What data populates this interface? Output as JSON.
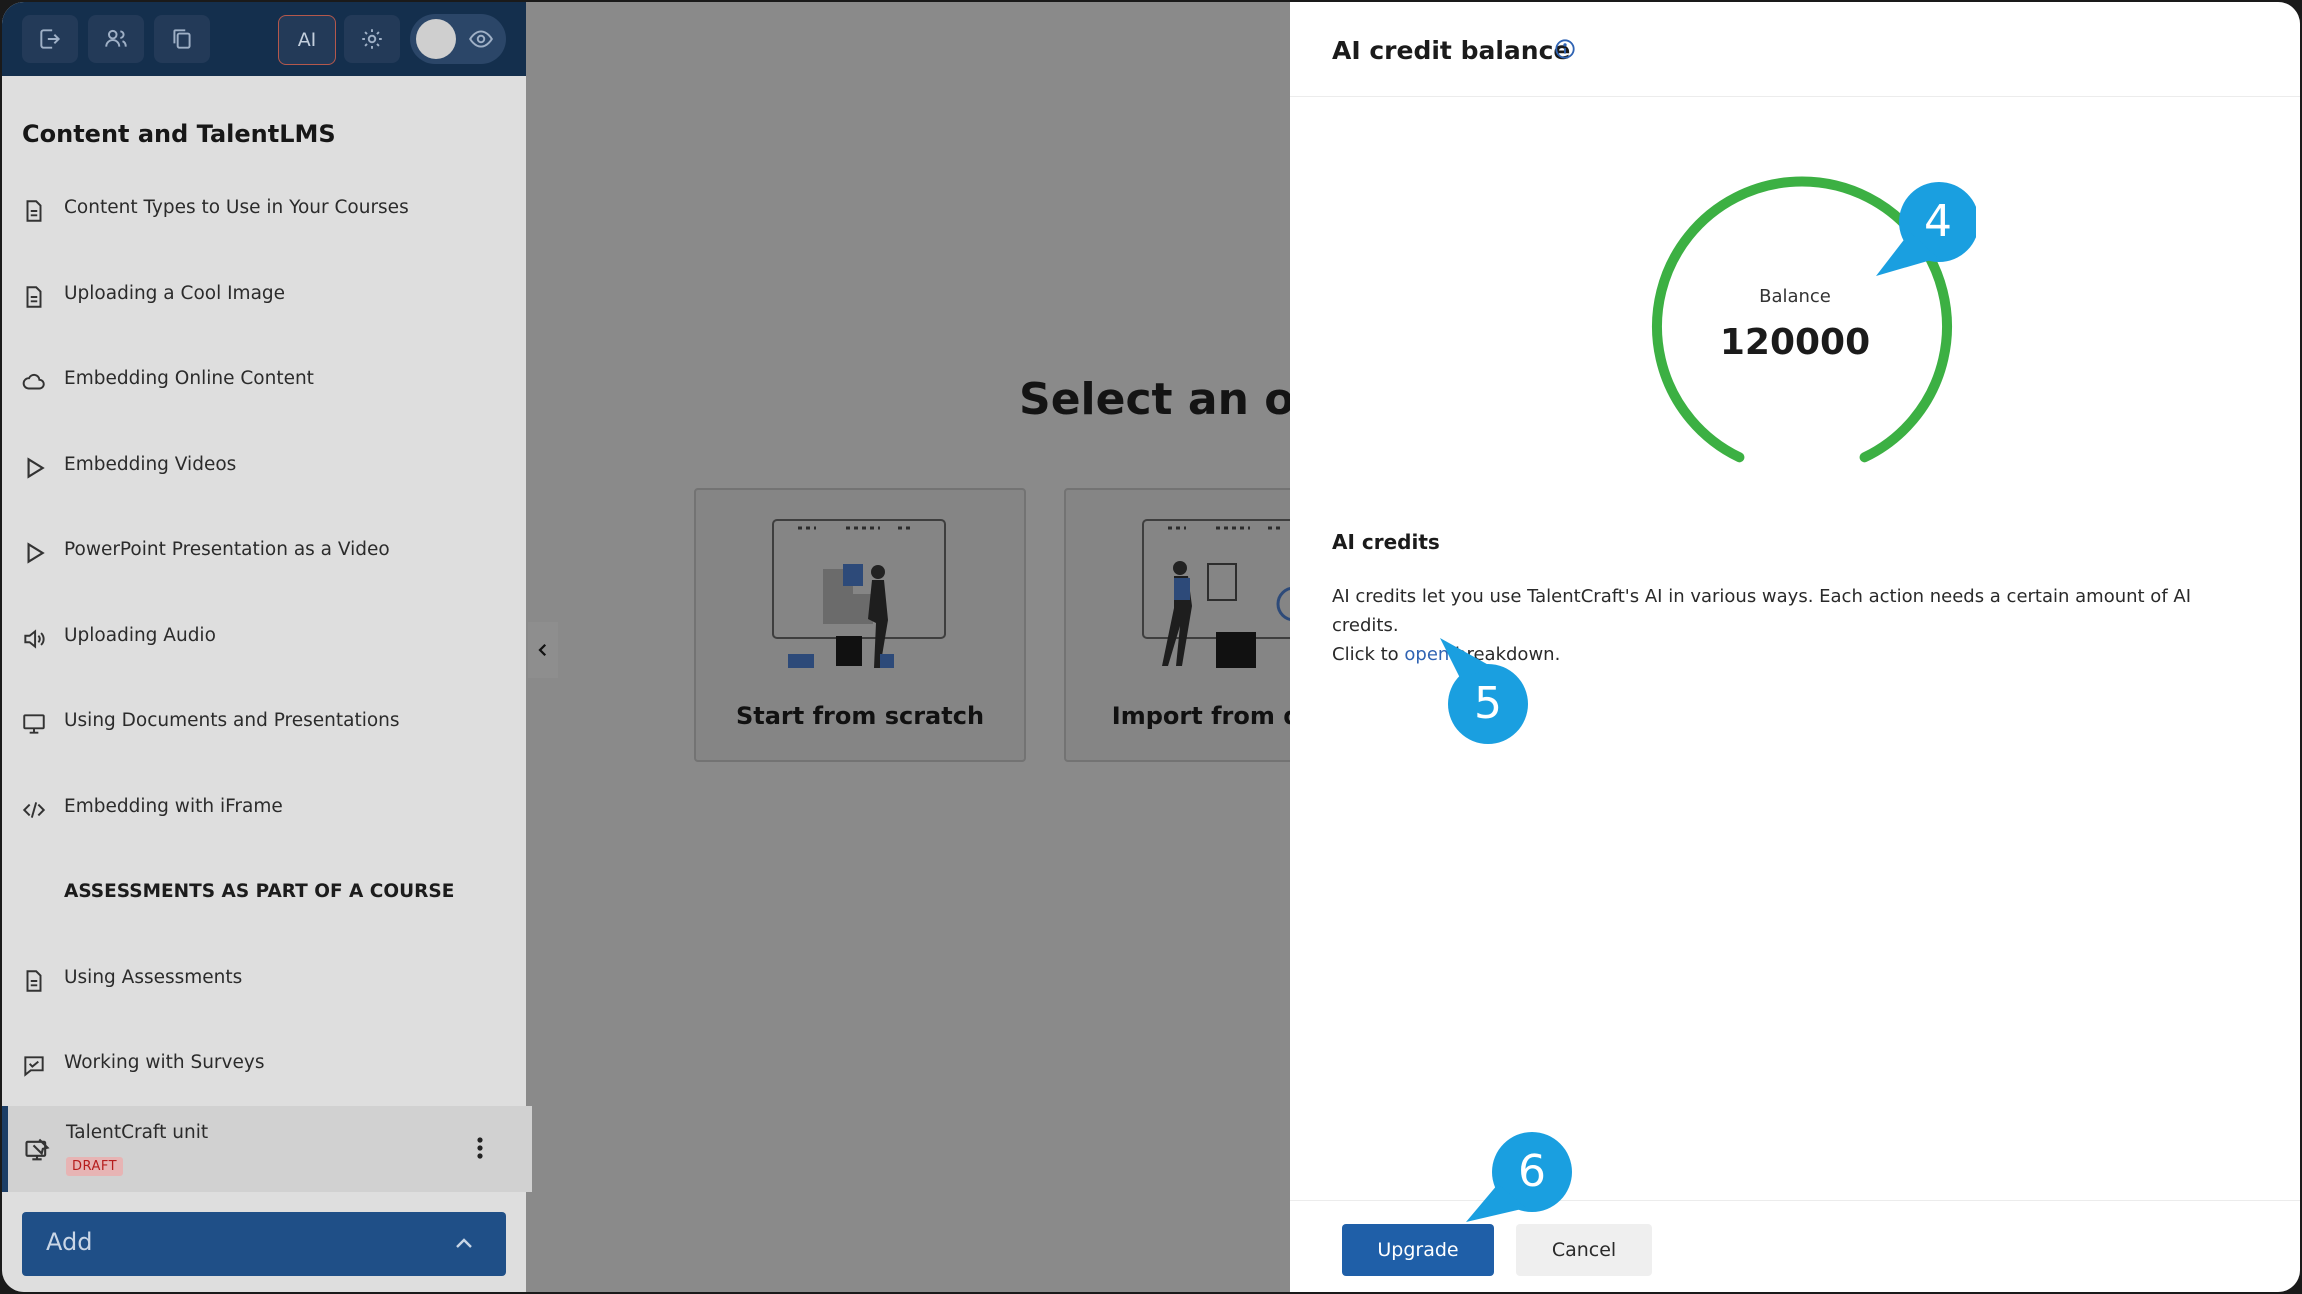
{
  "sidebar": {
    "toolbar": {
      "ai_label": "AI"
    },
    "course_title": "Content and TalentLMS",
    "units": [
      {
        "label": "Content Types to Use in Your Courses",
        "icon": "document-icon"
      },
      {
        "label": "Uploading a Cool Image",
        "icon": "document-icon"
      },
      {
        "label": "Embedding Online Content",
        "icon": "cloud-icon"
      },
      {
        "label": "Embedding Videos",
        "icon": "play-icon"
      },
      {
        "label": "PowerPoint Presentation as a Video",
        "icon": "play-icon"
      },
      {
        "label": "Uploading Audio",
        "icon": "speaker-icon"
      },
      {
        "label": "Using Documents and Presentations",
        "icon": "monitor-icon"
      },
      {
        "label": "Embedding with iFrame",
        "icon": "code-icon"
      },
      {
        "label": "ASSESSMENTS AS PART OF A COURSE",
        "icon": ""
      },
      {
        "label": "Using Assessments",
        "icon": "document-icon"
      },
      {
        "label": "Working with Surveys",
        "icon": "survey-icon"
      }
    ],
    "active_unit": {
      "label": "TalentCraft unit",
      "badge": "DRAFT"
    },
    "add_label": "Add"
  },
  "main": {
    "title": "Select an opt",
    "options": [
      {
        "label": "Start from scratch"
      },
      {
        "label": "Import from docu"
      }
    ]
  },
  "panel": {
    "title": "AI credit balance",
    "gauge": {
      "label": "Balance",
      "value": "120000",
      "color": "#3cb043"
    },
    "credits_heading": "AI credits",
    "credits_desc_1": "AI credits let you use TalentCraft's AI in various ways. Each action needs a certain amount of AI credits.",
    "credits_desc_2_prefix": "Click to ",
    "credits_desc_link": "open",
    "credits_desc_2_suffix": " breakdown.",
    "upgrade_label": "Upgrade",
    "cancel_label": "Cancel"
  },
  "callouts": [
    {
      "number": "4"
    },
    {
      "number": "5"
    },
    {
      "number": "6"
    }
  ],
  "colors": {
    "callout": "#1a9fe0",
    "primary_button": "#1f5fa8",
    "link": "#2f63b3"
  }
}
